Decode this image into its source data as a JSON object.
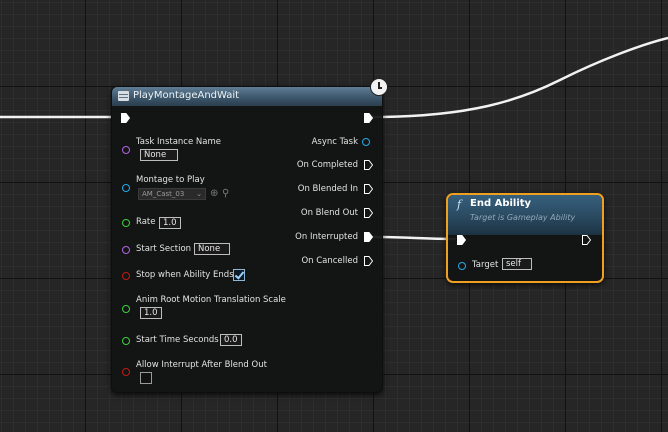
{
  "colors": {
    "exec": "#ffffff",
    "object_pin": "#2aa7e6",
    "string_pin": "#b464e0",
    "float_pin": "#3ad03a",
    "bool_pin": "#c01a1a",
    "selected_border": "#f0a020"
  },
  "play_node": {
    "title": "PlayMontageAndWait",
    "header_icon": "function-node-icon",
    "latent_icon": "clock-icon",
    "inputs": {
      "task_instance_name": {
        "label": "Task Instance Name",
        "value": "None"
      },
      "montage_to_play": {
        "label": "Montage to Play",
        "value": "AM_Cast_03"
      },
      "rate": {
        "label": "Rate",
        "value": "1.0"
      },
      "start_section": {
        "label": "Start Section",
        "value": "None"
      },
      "stop_when_ability_ends": {
        "label": "Stop when Ability Ends",
        "checked": true
      },
      "anim_root_motion_translation_scale": {
        "label": "Anim Root Motion Translation Scale",
        "value": "1.0"
      },
      "start_time_seconds": {
        "label": "Start Time Seconds",
        "value": "0.0"
      },
      "allow_interrupt_after_blend_out": {
        "label": "Allow Interrupt After Blend Out",
        "checked": false
      }
    },
    "outputs": {
      "async_task": "Async Task",
      "on_completed": "On Completed",
      "on_blended_in": "On Blended In",
      "on_blend_out": "On Blend Out",
      "on_interrupted": "On Interrupted",
      "on_cancelled": "On Cancelled"
    }
  },
  "end_node": {
    "title": "End Ability",
    "subtitle": "Target is Gameplay Ability",
    "function_glyph": "f",
    "target_label": "Target",
    "target_value": "self"
  }
}
